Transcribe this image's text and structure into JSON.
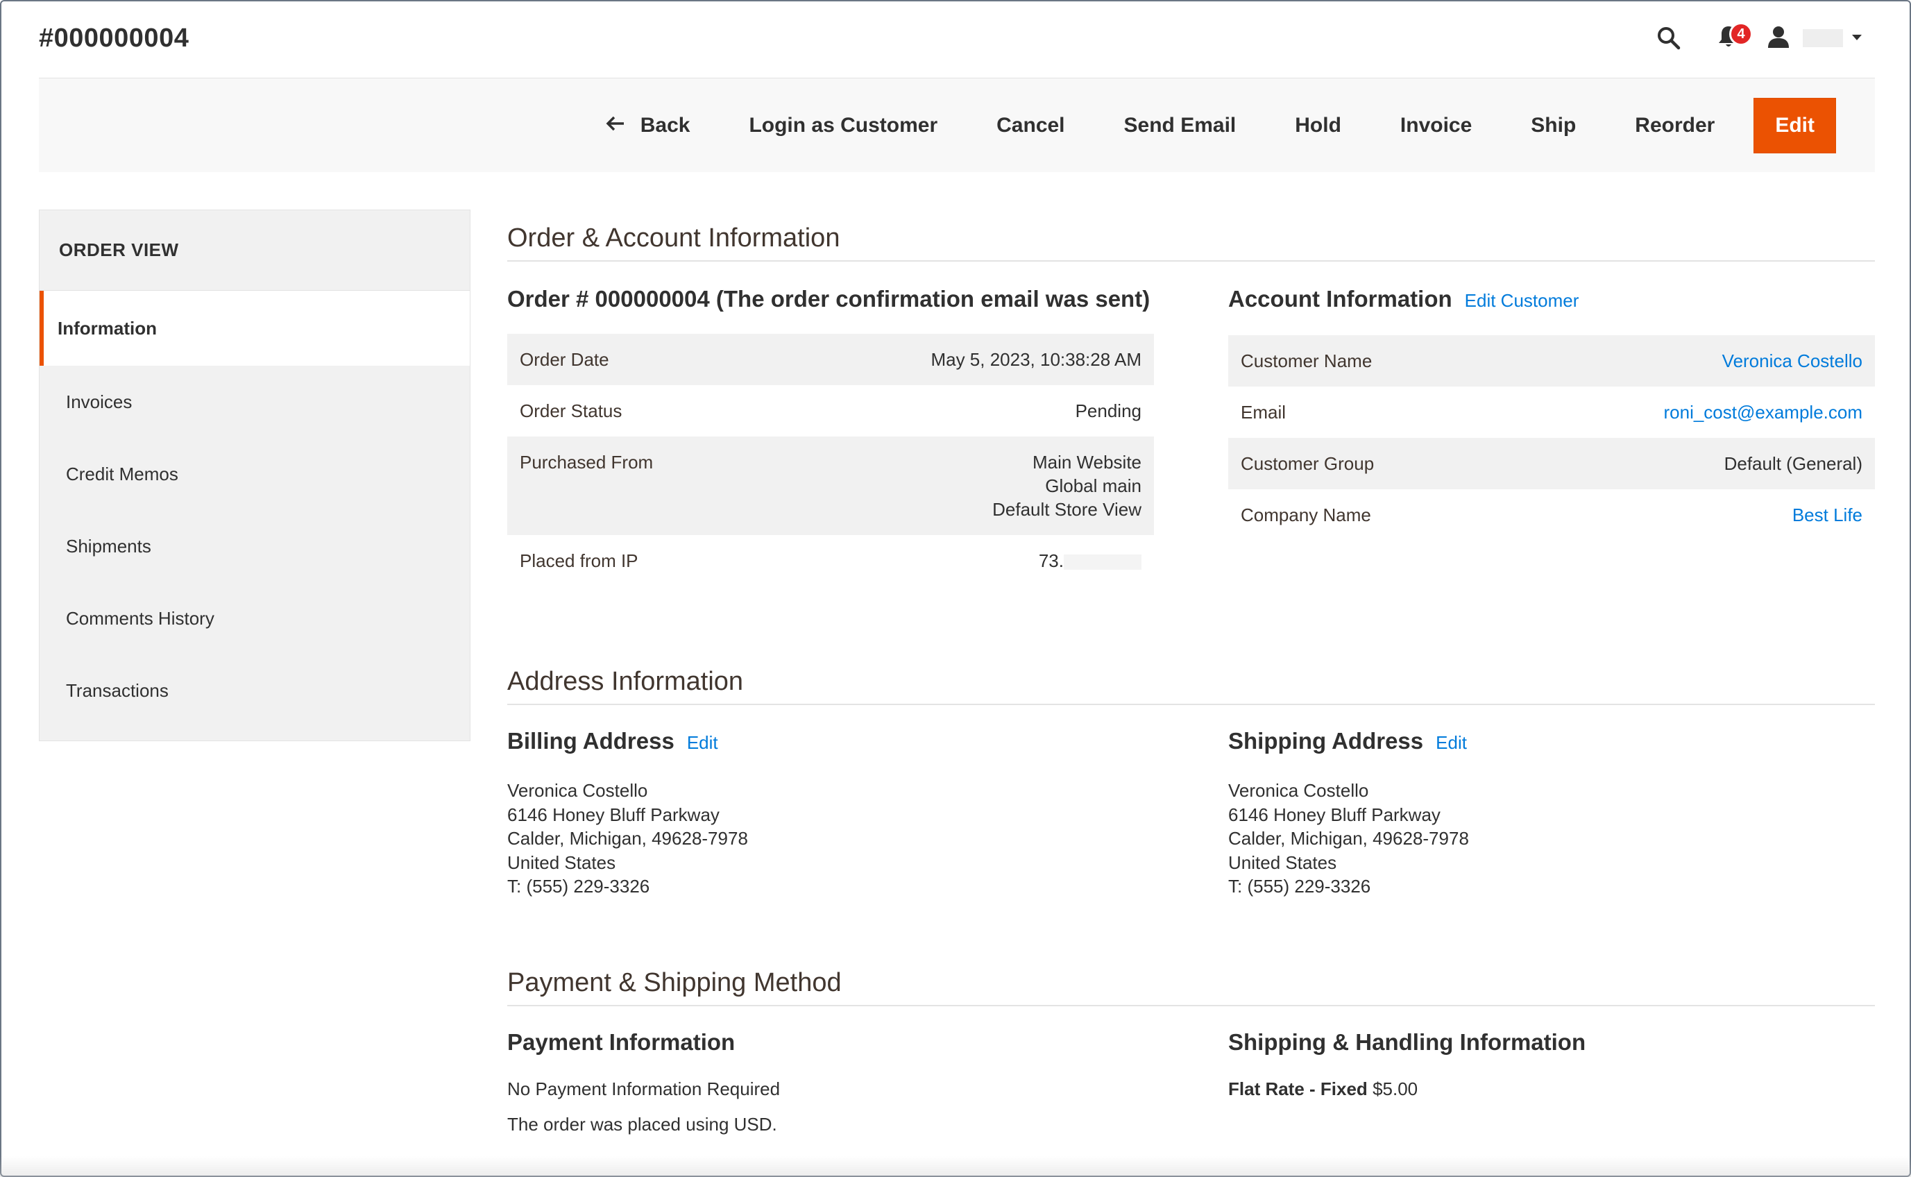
{
  "page": {
    "title": "#000000004"
  },
  "header": {
    "notification_count": "4",
    "icons": [
      "search-icon",
      "bell-icon",
      "user-icon",
      "caret-down-icon"
    ]
  },
  "toolbar": {
    "back_label": "Back",
    "login_as_customer_label": "Login as Customer",
    "cancel_label": "Cancel",
    "send_email_label": "Send Email",
    "hold_label": "Hold",
    "invoice_label": "Invoice",
    "ship_label": "Ship",
    "reorder_label": "Reorder",
    "edit_label": "Edit",
    "edit_color": "#eb5202"
  },
  "sidebar": {
    "title": "ORDER VIEW",
    "items": [
      {
        "label": "Information",
        "active": true
      },
      {
        "label": "Invoices"
      },
      {
        "label": "Credit Memos"
      },
      {
        "label": "Shipments"
      },
      {
        "label": "Comments History"
      },
      {
        "label": "Transactions"
      }
    ]
  },
  "order_account": {
    "section_title": "Order & Account Information",
    "order_heading": "Order # 000000004 (The order confirmation email was sent)",
    "rows": [
      {
        "label": "Order Date",
        "value": "May 5, 2023, 10:38:28 AM"
      },
      {
        "label": "Order Status",
        "value": "Pending"
      },
      {
        "label": "Purchased From",
        "value_lines": [
          "Main Website",
          "Global main",
          "Default Store View"
        ]
      },
      {
        "label": "Placed from IP",
        "value": "73."
      }
    ],
    "account_heading": "Account Information",
    "edit_customer_label": "Edit Customer",
    "account_rows": [
      {
        "label": "Customer Name",
        "value": "Veronica Costello"
      },
      {
        "label": "Email",
        "value": "roni_cost@example.com"
      },
      {
        "label": "Customer Group",
        "value": "Default (General)"
      },
      {
        "label": "Company Name",
        "value": "Best Life"
      }
    ]
  },
  "address": {
    "section_title": "Address Information",
    "billing_heading": "Billing Address",
    "shipping_heading": "Shipping Address",
    "edit_label": "Edit",
    "billing_lines": [
      "Veronica Costello",
      "6146 Honey Bluff Parkway",
      "Calder, Michigan, 49628-7978",
      "United States",
      "T: (555) 229-3326"
    ],
    "shipping_lines": [
      "Veronica Costello",
      "6146 Honey Bluff Parkway",
      "Calder, Michigan, 49628-7978",
      "United States",
      "T: (555) 229-3326"
    ]
  },
  "payment_shipping": {
    "section_title": "Payment & Shipping Method",
    "payment_heading": "Payment Information",
    "payment_line1": "No Payment Information Required",
    "payment_line2": "The order was placed using USD.",
    "shipping_heading": "Shipping & Handling Information",
    "shipping_method": "Flat Rate - Fixed",
    "shipping_price": "$5.00"
  },
  "colors": {
    "accent": "#eb5202",
    "link": "#007bdb",
    "badge": "#e22626"
  }
}
